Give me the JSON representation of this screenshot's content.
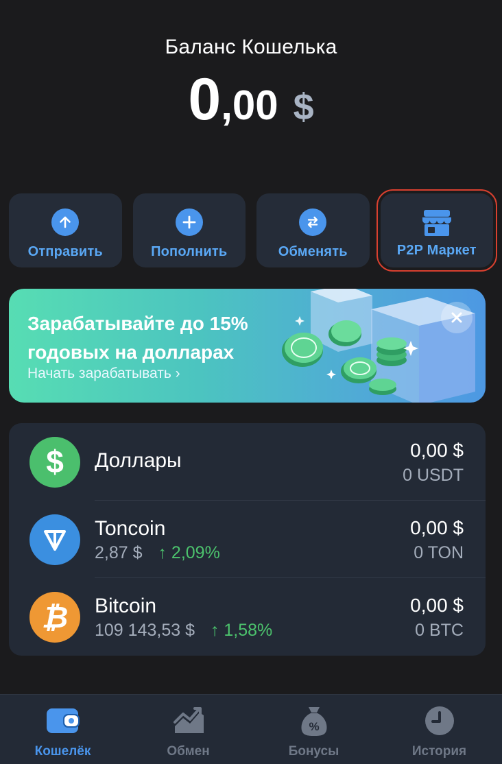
{
  "balance": {
    "title": "Баланс Кошелька",
    "integer": "0",
    "decimal": ",00",
    "currency": "$"
  },
  "actions": [
    {
      "label": "Отправить",
      "icon": "arrow-up-icon"
    },
    {
      "label": "Пополнить",
      "icon": "plus-icon"
    },
    {
      "label": "Обменять",
      "icon": "swap-icon"
    },
    {
      "label": "P2P Маркет",
      "icon": "store-icon"
    }
  ],
  "promo": {
    "title": "Зарабатывайте до 15% годовых на долларах",
    "link": "Начать зарабатывать ›"
  },
  "assets": [
    {
      "name": "Доллары",
      "fiat": "0,00 $",
      "amount": "0 USDT",
      "price": "",
      "change": "",
      "icon": "usdt-icon",
      "color": "#4bbf6d"
    },
    {
      "name": "Toncoin",
      "fiat": "0,00 $",
      "amount": "0 TON",
      "price": "2,87 $",
      "change": "↑ 2,09%",
      "icon": "ton-icon",
      "color": "#3b8fe0"
    },
    {
      "name": "Bitcoin",
      "fiat": "0,00 $",
      "amount": "0 BTC",
      "price": "109 143,53 $",
      "change": "↑ 1,58%",
      "icon": "bitcoin-icon",
      "color": "#ef9834"
    }
  ],
  "tabs": [
    {
      "label": "Кошелёк",
      "icon": "wallet-icon",
      "active": true
    },
    {
      "label": "Обмен",
      "icon": "chart-icon",
      "active": false
    },
    {
      "label": "Бонусы",
      "icon": "money-bag-icon",
      "active": false
    },
    {
      "label": "История",
      "icon": "clock-icon",
      "active": false
    }
  ],
  "colors": {
    "accent": "#4a95ec",
    "positive": "#4cc36d",
    "highlight_border": "#d9402f",
    "background": "#1b1b1d",
    "card": "#232a36"
  }
}
